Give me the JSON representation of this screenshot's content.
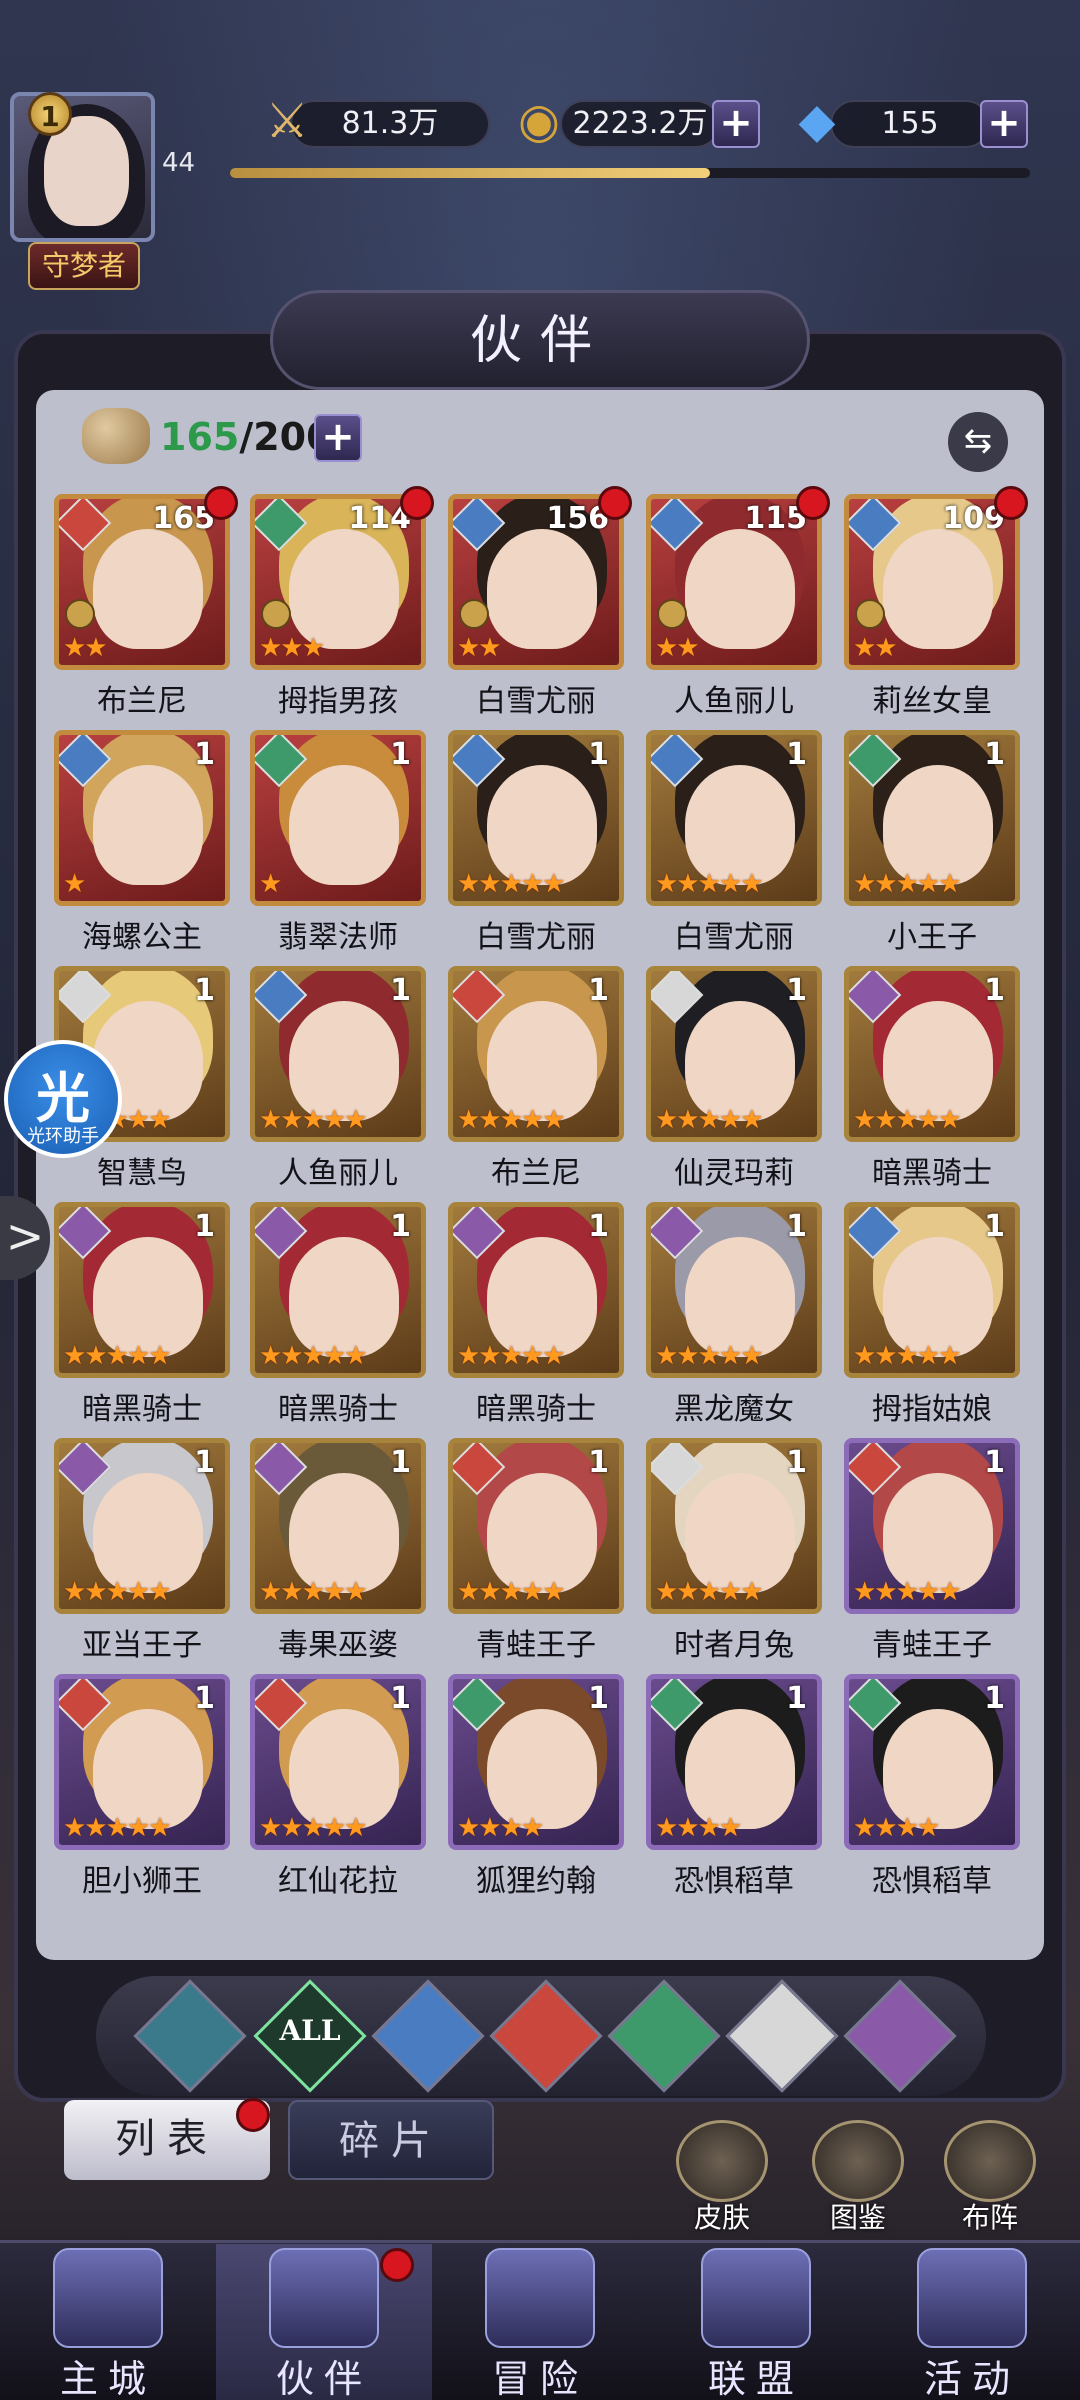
{
  "player": {
    "level": "1",
    "exp_level": "44",
    "title": "守梦者",
    "exp_progress": 0.6
  },
  "resources": {
    "power": "81.3万",
    "gold": "2223.2万",
    "diamond": "155"
  },
  "panel": {
    "title": "伙伴",
    "roster_current": "165",
    "roster_max": "/200"
  },
  "icons": {
    "plus": "+",
    "swap": "⇆"
  },
  "heroes": [
    {
      "name": "布兰尼",
      "count": "165",
      "stars": "★★",
      "bg": "red",
      "elem": "#c9473c",
      "hair": "#c8974d",
      "dot": true,
      "rank": true
    },
    {
      "name": "拇指男孩",
      "count": "114",
      "stars": "★★★",
      "bg": "red",
      "elem": "#3f9a6b",
      "hair": "#d9b458",
      "dot": true,
      "rank": true
    },
    {
      "name": "白雪尤丽",
      "count": "156",
      "stars": "★★",
      "bg": "red",
      "elem": "#4a7cc2",
      "hair": "#2b1f1a",
      "dot": true,
      "rank": true
    },
    {
      "name": "人鱼丽儿",
      "count": "115",
      "stars": "★★",
      "bg": "red",
      "elem": "#4a7cc2",
      "hair": "#8f2a2e",
      "dot": true,
      "rank": true
    },
    {
      "name": "莉丝女皇",
      "count": "109",
      "stars": "★★",
      "bg": "red",
      "elem": "#4a7cc2",
      "hair": "#e6c98a",
      "dot": true,
      "rank": true
    },
    {
      "name": "海螺公主",
      "count": "1",
      "stars": "★",
      "bg": "red",
      "elem": "#4a7cc2",
      "hair": "#d1a65c"
    },
    {
      "name": "翡翠法师",
      "count": "1",
      "stars": "★",
      "bg": "red",
      "elem": "#3f9a6b",
      "hair": "#c98b3c"
    },
    {
      "name": "白雪尤丽",
      "count": "1",
      "stars": "★★★★★",
      "bg": "gold",
      "elem": "#4a7cc2",
      "hair": "#2b1f1a"
    },
    {
      "name": "白雪尤丽",
      "count": "1",
      "stars": "★★★★★",
      "bg": "gold",
      "elem": "#4a7cc2",
      "hair": "#2b1f1a"
    },
    {
      "name": "小王子",
      "count": "1",
      "stars": "★★★★★",
      "bg": "gold",
      "elem": "#3f9a6b",
      "hair": "#2c2018"
    },
    {
      "name": "智慧鸟",
      "count": "1",
      "stars": "★★★★★",
      "bg": "gold",
      "elem": "#d7d7d7",
      "hair": "#e7c97a"
    },
    {
      "name": "人鱼丽儿",
      "count": "1",
      "stars": "★★★★★",
      "bg": "gold",
      "elem": "#4a7cc2",
      "hair": "#8f2a2e"
    },
    {
      "name": "布兰尼",
      "count": "1",
      "stars": "★★★★★",
      "bg": "gold",
      "elem": "#c9473c",
      "hair": "#c8974d"
    },
    {
      "name": "仙灵玛莉",
      "count": "1",
      "stars": "★★★★★",
      "bg": "gold",
      "elem": "#d7d7d7",
      "hair": "#1f1e22"
    },
    {
      "name": "暗黑骑士",
      "count": "1",
      "stars": "★★★★★",
      "bg": "gold",
      "elem": "#8a5aa8",
      "hair": "#a32a34"
    },
    {
      "name": "暗黑骑士",
      "count": "1",
      "stars": "★★★★★",
      "bg": "gold",
      "elem": "#8a5aa8",
      "hair": "#a32a34"
    },
    {
      "name": "暗黑骑士",
      "count": "1",
      "stars": "★★★★★",
      "bg": "gold",
      "elem": "#8a5aa8",
      "hair": "#a32a34"
    },
    {
      "name": "暗黑骑士",
      "count": "1",
      "stars": "★★★★★",
      "bg": "gold",
      "elem": "#8a5aa8",
      "hair": "#a32a34"
    },
    {
      "name": "黑龙魔女",
      "count": "1",
      "stars": "★★★★★",
      "bg": "gold",
      "elem": "#8a5aa8",
      "hair": "#9a9aa8"
    },
    {
      "name": "拇指姑娘",
      "count": "1",
      "stars": "★★★★★",
      "bg": "gold",
      "elem": "#4a7cc2",
      "hair": "#e6c98a"
    },
    {
      "name": "亚当王子",
      "count": "1",
      "stars": "★★★★★",
      "bg": "gold",
      "elem": "#8a5aa8",
      "hair": "#c7c7cc"
    },
    {
      "name": "毒果巫婆",
      "count": "1",
      "stars": "★★★★★",
      "bg": "gold",
      "elem": "#8a5aa8",
      "hair": "#6b5a3a"
    },
    {
      "name": "青蛙王子",
      "count": "1",
      "stars": "★★★★★",
      "bg": "gold",
      "elem": "#c9473c",
      "hair": "#b34848"
    },
    {
      "name": "时者月兔",
      "count": "1",
      "stars": "★★★★★",
      "bg": "gold",
      "elem": "#d7d7d7",
      "hair": "#e4d5c1"
    },
    {
      "name": "青蛙王子",
      "count": "1",
      "stars": "★★★★★",
      "bg": "purple",
      "elem": "#c9473c",
      "hair": "#b34848"
    },
    {
      "name": "胆小狮王",
      "count": "1",
      "stars": "★★★★★",
      "bg": "purple",
      "elem": "#c9473c",
      "hair": "#d19b52"
    },
    {
      "name": "红仙花拉",
      "count": "1",
      "stars": "★★★★★",
      "bg": "purple",
      "elem": "#c9473c",
      "hair": "#d19b52"
    },
    {
      "name": "狐狸约翰",
      "count": "1",
      "stars": "★★★★",
      "bg": "purple",
      "elem": "#3f9a6b",
      "hair": "#7a4a2a"
    },
    {
      "name": "恐惧稻草",
      "count": "1",
      "stars": "★★★★",
      "bg": "purple",
      "elem": "#3f9a6b",
      "hair": "#1c1c1c"
    },
    {
      "name": "恐惧稻草",
      "count": "1",
      "stars": "★★★★",
      "bg": "purple",
      "elem": "#3f9a6b",
      "hair": "#1c1c1c"
    }
  ],
  "filters": [
    {
      "label": "",
      "name": "filter-water-icon",
      "color": "#3a7a8a"
    },
    {
      "label": "ALL",
      "name": "filter-all-icon",
      "color": "#1e3a2c",
      "active": true
    },
    {
      "label": "",
      "name": "filter-ice-icon",
      "color": "#4a7cc2"
    },
    {
      "label": "",
      "name": "filter-fire-icon",
      "color": "#c9473c"
    },
    {
      "label": "",
      "name": "filter-wind-icon",
      "color": "#3f9a6b"
    },
    {
      "label": "",
      "name": "filter-light-icon",
      "color": "#d7d7d7"
    },
    {
      "label": "",
      "name": "filter-dark-icon",
      "color": "#8a5aa8"
    }
  ],
  "tabs": {
    "list": "列表",
    "fragments": "碎片"
  },
  "side_actions": [
    {
      "label": "皮肤"
    },
    {
      "label": "图鉴"
    },
    {
      "label": "布阵"
    }
  ],
  "nav": [
    {
      "label": "主城"
    },
    {
      "label": "伙伴"
    },
    {
      "label": "冒险"
    },
    {
      "label": "联盟"
    },
    {
      "label": "活动"
    }
  ],
  "assistant": {
    "glyph": "光",
    "label": "光环助手"
  },
  "edge_tab": ">"
}
